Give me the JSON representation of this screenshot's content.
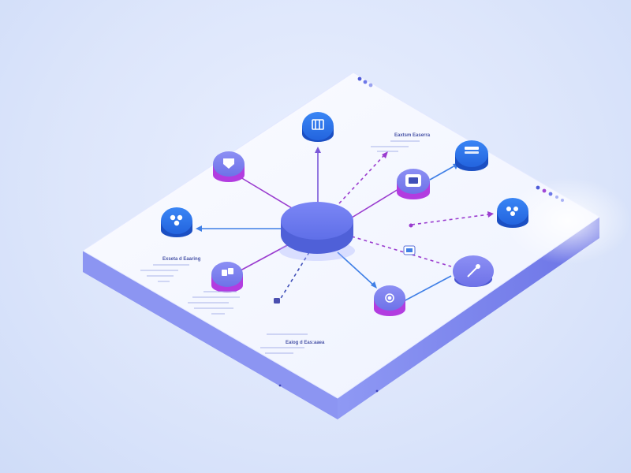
{
  "colors": {
    "background": "#dde6fb",
    "board_top": "#f7f9ff",
    "board_side": "#7a83ee",
    "hub": "#6a78f2",
    "node_blue": "#2f78ef",
    "node_purple_accent": "#b23ce0",
    "edge_purple": "#9a3ccf",
    "edge_blue": "#3f7fe6"
  },
  "labels": {
    "top_right_title": "Eaxtsm Easerra",
    "left_title": "Exseta d Eaaring",
    "bottom_title": "Eaiog d Eas:aaea"
  },
  "nodes": [
    {
      "id": "node-top",
      "icon": "document-icon",
      "style": "blue"
    },
    {
      "id": "node-upper-left",
      "icon": "shield-icon",
      "style": "purple"
    },
    {
      "id": "node-left",
      "icon": "leaf-icon",
      "style": "blue"
    },
    {
      "id": "node-lower-left",
      "icon": "cube-icon",
      "style": "purple"
    },
    {
      "id": "node-right-upper",
      "icon": "folder-icon",
      "style": "blue"
    },
    {
      "id": "node-right-middle",
      "icon": "box-icon",
      "style": "purple"
    },
    {
      "id": "node-far-right",
      "icon": "leaf-icon",
      "style": "blue"
    },
    {
      "id": "node-lower-right",
      "icon": "link-icon",
      "style": "round"
    },
    {
      "id": "node-bottom",
      "icon": "gear-icon",
      "style": "purple"
    }
  ]
}
